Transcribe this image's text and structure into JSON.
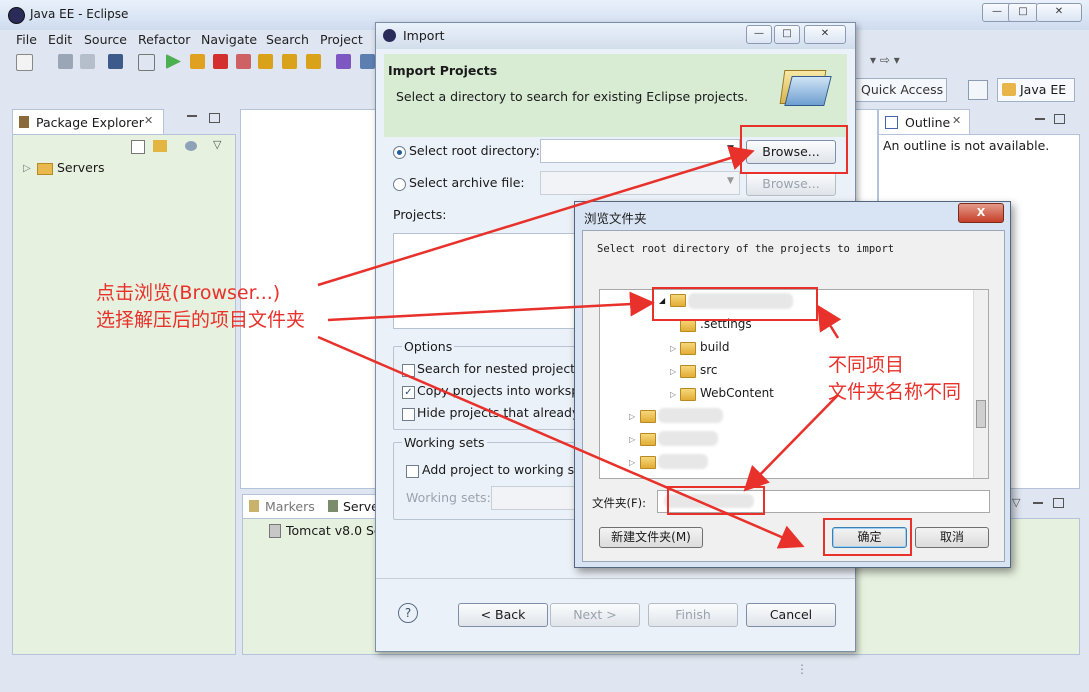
{
  "window": {
    "title": "Java EE - Eclipse"
  },
  "menu": [
    "File",
    "Edit",
    "Source",
    "Refactor",
    "Navigate",
    "Search",
    "Project"
  ],
  "toolbar": {
    "quick_access_placeholder": "Quick Access",
    "perspective": "Java EE"
  },
  "package_explorer": {
    "tab": "Package Explorer",
    "items": [
      "Servers"
    ]
  },
  "outline": {
    "tab": "Outline",
    "message": "An outline is not available."
  },
  "bottom_panel": {
    "tabs": [
      "Markers",
      "Serve"
    ],
    "rows": [
      "Tomcat v8.0 Se"
    ]
  },
  "import_dialog": {
    "title": "Import",
    "heading": "Import Projects",
    "description": "Select a directory to search for existing Eclipse projects.",
    "root_label": "Select root directory:",
    "archive_label": "Select archive file:",
    "browse_button": "Browse...",
    "browse_button_disabled": "Browse...",
    "projects_label": "Projects:",
    "options_label": "Options",
    "opt_nested": "Search for nested projects",
    "opt_copy": "Copy projects into workspa",
    "opt_hide": "Hide projects that already e",
    "working_sets_label": "Working sets",
    "add_to_ws": "Add project to working se",
    "working_sets_field": "Working sets:",
    "back": "< Back",
    "next": "Next >",
    "finish": "Finish",
    "cancel": "Cancel",
    "help": "?"
  },
  "browse_dialog": {
    "title": "浏览文件夹",
    "prompt": "Select root directory of the projects to import",
    "tree": [
      ".settings",
      "build",
      "src",
      "WebContent"
    ],
    "folder_label": "文件夹(F):",
    "new_folder": "新建文件夹(M)",
    "ok": "确定",
    "cancel": "取消",
    "close": "X"
  },
  "annotations": {
    "left_line1": "点击浏览(Browser...)",
    "left_line2": "选择解压后的项目文件夹",
    "right_line1": "不同项目",
    "right_line2": "文件夹名称不同"
  },
  "colors": {
    "annotation_red": "#e8312b",
    "banner_green": "#d8ecd4",
    "panel_green": "#e7f1df"
  }
}
